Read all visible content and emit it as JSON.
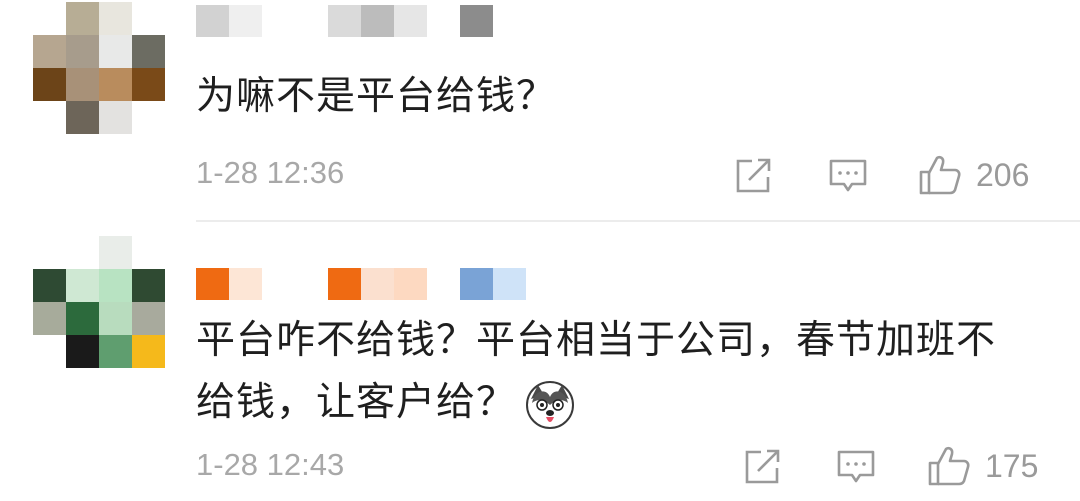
{
  "comments": [
    {
      "text": "为嘛不是平台给钱？",
      "timestamp": "1-28 12:36",
      "likes": "206",
      "avatar_colors": [
        "#ffffff",
        "#b7ad95",
        "#e8e6de",
        "#ffffff",
        "#b6a690",
        "#a79c8c",
        "#e8e9e8",
        "#6c6c62",
        "#6c4418",
        "#a89178",
        "#b98c5d",
        "#7a4a18",
        "#ffffff",
        "#6d6559",
        "#e3e2e0",
        "#ffffff"
      ],
      "name_blocks": [
        "#d2d2d2",
        "#efefef",
        "#ffffff",
        "#ffffff",
        "#dadada",
        "#bcbcbc",
        "#e6e6e6",
        "#ffffff",
        "#8c8c8c"
      ]
    },
    {
      "text_line1": "平台咋不给钱？平台相当于公司，春节加班不",
      "text_line2": "给钱，让客户给？",
      "timestamp": "1-28 12:43",
      "likes": "175",
      "emoji_icon": "husky-dog-emoji-icon",
      "avatar_colors": [
        "#ffffff",
        "#ffffff",
        "#e9ede9",
        "#ffffff",
        "#2e4a33",
        "#cfe8d3",
        "#b8e3c2",
        "#2f4a32",
        "#a7ab9b",
        "#2c6a3c",
        "#b8dcbe",
        "#a8aa9d",
        "#ffffff",
        "#1a1a1a",
        "#5f9e6f",
        "#f5b91b"
      ],
      "name_blocks": [
        "#ef6a12",
        "#fde6d6",
        "#ffffff",
        "#ffffff",
        "#ef6a12",
        "#fbe0cf",
        "#fdd9c1",
        "#ffffff",
        "#7aa3d6",
        "#cfe3f8"
      ]
    }
  ],
  "actions": {
    "share_icon": "share-icon",
    "reply_icon": "reply-icon",
    "like_icon": "thumbs-up-icon"
  }
}
